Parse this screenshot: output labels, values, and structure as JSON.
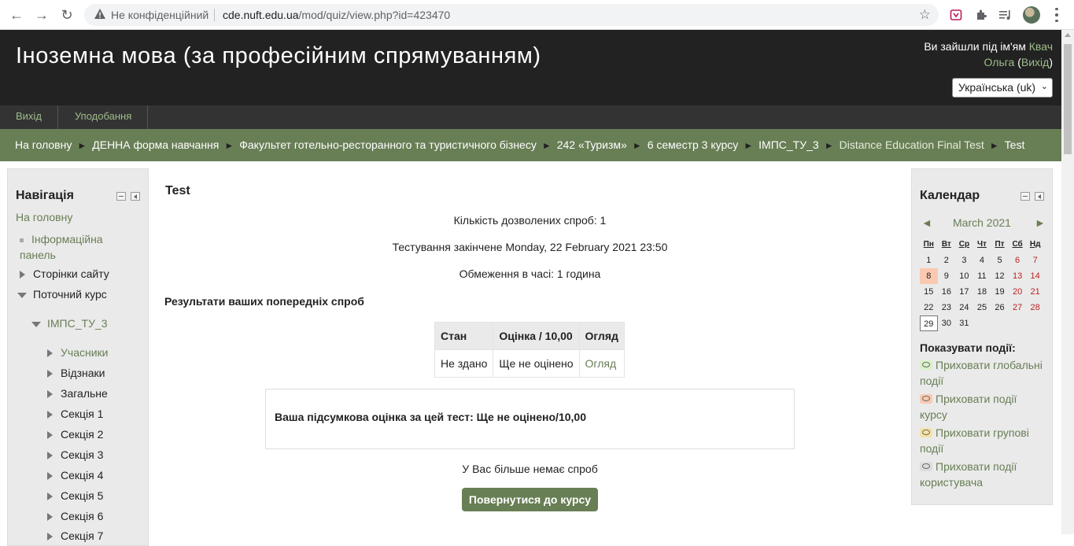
{
  "browser": {
    "security_label": "Не конфіденційний",
    "url_host": "cde.nuft.edu.ua",
    "url_path": "/mod/quiz/view.php?id=423470"
  },
  "header": {
    "course_title": "Іноземна мова (за професійним спрямуванням)",
    "login_prefix": "Ви зайшли під ім'ям",
    "user_name": "Квач Ольга",
    "logout_link": "Вихід",
    "language": "Українська (uk)"
  },
  "custom_menu": [
    "Вихід",
    "Уподобання"
  ],
  "breadcrumb": [
    "На головну",
    "ДЕННА форма навчання",
    "Факультет готельно-ресторанного та туристичного бізнесу",
    "242 «Туризм»",
    "6 семестр 3 курсу",
    "ІМПС_ТУ_3",
    "Distance Education Final Test",
    "Test"
  ],
  "navigation": {
    "title": "Навігація",
    "home": "На головну",
    "dashboard": "Інформаційна панель",
    "site_pages": "Сторінки сайту",
    "current_course": "Поточний курс",
    "course_short": "ІМПС_ТУ_3",
    "items": [
      "Учасники",
      "Відзнаки",
      "Загальне",
      "Секція 1",
      "Секція 2",
      "Секція 3",
      "Секція 4",
      "Секція 5",
      "Секція 6",
      "Секція 7"
    ]
  },
  "main": {
    "title": "Test",
    "attempts_allowed": "Кількість дозволених спроб: 1",
    "closed_on": "Тестування закінчене Monday, 22 February 2021 23:50",
    "time_limit": "Обмеження в часі: 1 година",
    "previous_attempts_heading": "Результати ваших попередніх спроб",
    "table": {
      "headers": [
        "Стан",
        "Оцінка / 10,00",
        "Огляд"
      ],
      "rows": [
        [
          "Не здано",
          "Ще не оцінено",
          "Огляд"
        ]
      ]
    },
    "final_grade": "Ваша підсумкова оцінка за цей тест: Ще не оцінено/10,00",
    "no_more_attempts": "У Вас більше немає спроб",
    "back_button": "Повернутися до курсу"
  },
  "calendar": {
    "title": "Календар",
    "month": "March 2021",
    "prev_arrow": "◄",
    "next_arrow": "►",
    "weekdays": [
      "Пн",
      "Вт",
      "Ср",
      "Чт",
      "Пт",
      "Сб",
      "Нд"
    ],
    "weeks": [
      [
        "1",
        "2",
        "3",
        "4",
        "5",
        "6",
        "7"
      ],
      [
        "8",
        "9",
        "10",
        "11",
        "12",
        "13",
        "14"
      ],
      [
        "15",
        "16",
        "17",
        "18",
        "19",
        "20",
        "21"
      ],
      [
        "22",
        "23",
        "24",
        "25",
        "26",
        "27",
        "28"
      ],
      [
        "29",
        "30",
        "31",
        "",
        "",
        "",
        ""
      ]
    ],
    "events_heading": "Показувати події:",
    "events": [
      {
        "label": "Приховати глобальні події",
        "color": "#d9f0c8"
      },
      {
        "label": "Приховати події курсу",
        "color": "#fac9b0"
      },
      {
        "label": "Приховати групові події",
        "color": "#f5e1a4"
      },
      {
        "label": "Приховати події користувача",
        "color": "#dcdcdc"
      }
    ]
  },
  "colors": {
    "accent": "#687e55",
    "header_bg": "#222222",
    "link": "#9ebc8a"
  }
}
